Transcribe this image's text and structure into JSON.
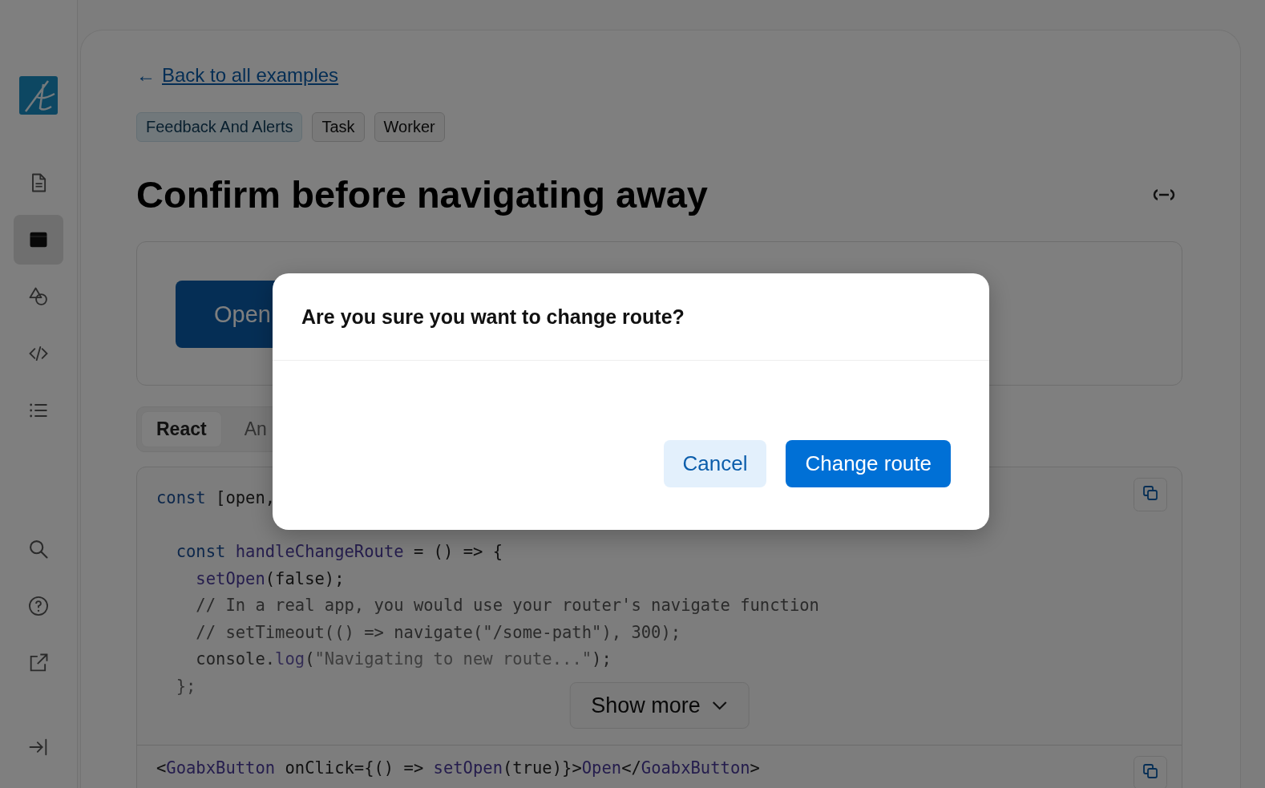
{
  "sidebar": {
    "items": [
      {
        "kind": "doc",
        "selected": false
      },
      {
        "kind": "window",
        "selected": true
      },
      {
        "kind": "shapes",
        "selected": false
      },
      {
        "kind": "code",
        "selected": false
      },
      {
        "kind": "list",
        "selected": false
      }
    ],
    "bottom_items": [
      {
        "kind": "search"
      },
      {
        "kind": "help"
      },
      {
        "kind": "external"
      },
      {
        "kind": "collapse"
      }
    ]
  },
  "back_link": {
    "arrow": "←",
    "label": "Back to all examples"
  },
  "tags": [
    {
      "label": "Feedback And Alerts",
      "kind": "category"
    },
    {
      "label": "Task",
      "kind": "plain"
    },
    {
      "label": "Worker",
      "kind": "plain"
    }
  ],
  "title": "Confirm before navigating away",
  "preview": {
    "button": "Open"
  },
  "code_tabs": [
    {
      "label": "React",
      "selected": true
    },
    {
      "label": "An",
      "selected": false
    }
  ],
  "code_blocks": [
    {
      "lines": [
        {
          "kind": "code",
          "tokens": [
            {
              "text": "const",
              "kind": "keyword"
            },
            {
              "text": " [open,",
              "kind": "plain"
            }
          ]
        },
        {
          "kind": "blank"
        },
        {
          "kind": "code",
          "tokens": [
            {
              "text": "  const",
              "kind": "keyword"
            },
            {
              "text": " handleChangeRoute",
              "kind": "function"
            },
            {
              "text": " = () => {",
              "kind": "plain"
            }
          ]
        },
        {
          "kind": "code",
          "tokens": [
            {
              "text": "    setOpen",
              "kind": "function"
            },
            {
              "text": "(false);",
              "kind": "plain"
            }
          ]
        },
        {
          "kind": "code",
          "tokens": [
            {
              "text": "    // In a real app, you would use your router's navigate function",
              "kind": "comment"
            }
          ]
        },
        {
          "kind": "code",
          "tokens": [
            {
              "text": "    // setTimeout(() => navigate(\"/some-path\"), 300);",
              "kind": "comment"
            }
          ]
        },
        {
          "kind": "code",
          "tokens": [
            {
              "text": "    console.",
              "kind": "plain"
            },
            {
              "text": "log",
              "kind": "function"
            },
            {
              "text": "(",
              "kind": "plain"
            },
            {
              "text": "\"Navigating to new route...\"",
              "kind": "string"
            },
            {
              "text": ");",
              "kind": "plain"
            }
          ]
        },
        {
          "kind": "code",
          "tokens": [
            {
              "text": "  };",
              "kind": "plain"
            }
          ]
        }
      ],
      "show_more": "Show more"
    },
    {
      "lines": [
        {
          "kind": "code",
          "tokens": [
            {
              "text": "<",
              "kind": "plain"
            },
            {
              "text": "GoabxButton",
              "kind": "function"
            },
            {
              "text": " onClick={() => ",
              "kind": "plain"
            },
            {
              "text": "setOpen",
              "kind": "function"
            },
            {
              "text": "(true)}>",
              "kind": "plain"
            },
            {
              "text": "Open",
              "kind": "function"
            },
            {
              "text": "</",
              "kind": "plain"
            },
            {
              "text": "GoabxButton",
              "kind": "function"
            },
            {
              "text": ">",
              "kind": "plain"
            }
          ]
        }
      ]
    }
  ],
  "dialog": {
    "title": "Are you sure you want to change route?",
    "buttons": [
      {
        "label": "Cancel",
        "kind": "secondary"
      },
      {
        "label": "Change route",
        "kind": "primary"
      }
    ]
  }
}
